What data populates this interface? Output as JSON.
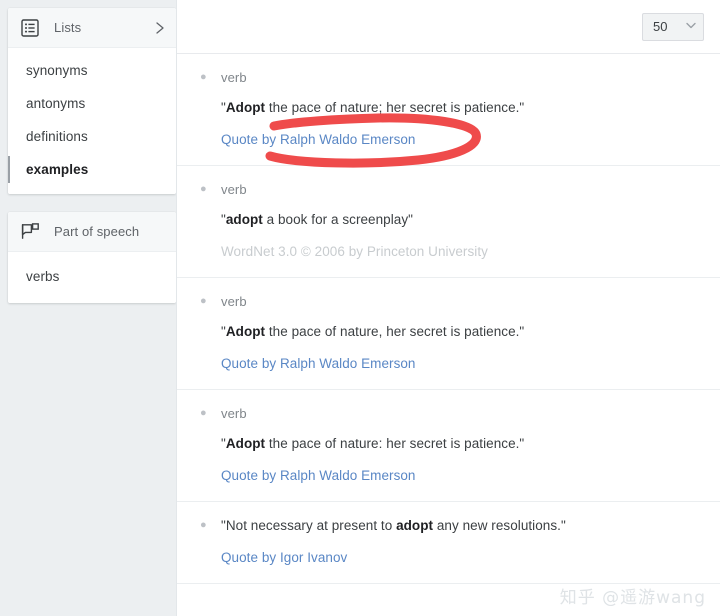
{
  "sidebar": {
    "lists_card": {
      "icon": "list-box-icon",
      "title": "Lists",
      "chevron": "chevron-right-icon",
      "items": [
        {
          "label": "synonyms",
          "selected": false
        },
        {
          "label": "antonyms",
          "selected": false
        },
        {
          "label": "definitions",
          "selected": false
        },
        {
          "label": "examples",
          "selected": true
        }
      ]
    },
    "pos_card": {
      "icon": "speech-flag-icon",
      "title": "Part of speech",
      "items": [
        {
          "label": "verbs",
          "selected": false
        }
      ]
    }
  },
  "main": {
    "toolbar": {
      "page_size_value": "50",
      "page_size_caret": "chevron-down-icon"
    },
    "entries": [
      {
        "bullet": "bullet-dot-icon",
        "pos": "verb",
        "quote_open": "\"",
        "headword": "Adopt",
        "rest": " the pace of nature; her secret is patience.\"",
        "source": "Quote by Ralph Waldo Emerson",
        "source_is_link": true,
        "annotated": true
      },
      {
        "bullet": "bullet-dot-icon",
        "pos": "verb",
        "quote_open": "\"",
        "headword": "adopt",
        "rest": " a book for a screenplay\"",
        "source": "WordNet 3.0 © 2006 by Princeton University",
        "source_is_link": false,
        "annotated": false
      },
      {
        "bullet": "bullet-dot-icon",
        "pos": "verb",
        "quote_open": "\"",
        "headword": "Adopt",
        "rest": " the pace of nature, her secret is patience.\"",
        "source": "Quote by Ralph Waldo Emerson",
        "source_is_link": true,
        "annotated": false
      },
      {
        "bullet": "bullet-dot-icon",
        "pos": "verb",
        "quote_open": "\"",
        "headword": "Adopt",
        "rest": " the pace of nature: her secret is patience.\"",
        "source": "Quote by Ralph Waldo Emerson",
        "source_is_link": true,
        "annotated": false
      },
      {
        "bullet": "bullet-dot-icon",
        "pos": "",
        "quote_open": "\"Not necessary at present to ",
        "headword": "adopt",
        "rest": " any new resolutions.\"",
        "source": "Quote by Igor Ivanov",
        "source_is_link": true,
        "annotated": false
      }
    ]
  },
  "annotation": {
    "shape": "hand-drawn-oval",
    "color": "#ef4b4b",
    "target": "Quote by Ralph Waldo Emerson"
  },
  "watermark": {
    "text": "知乎 @遥游wang"
  },
  "colors": {
    "page_background": "#eceff1",
    "panel_background": "#ffffff",
    "link": "#5a87c5",
    "muted_text": "#80868b",
    "annotation_red": "#ef4b4b"
  }
}
